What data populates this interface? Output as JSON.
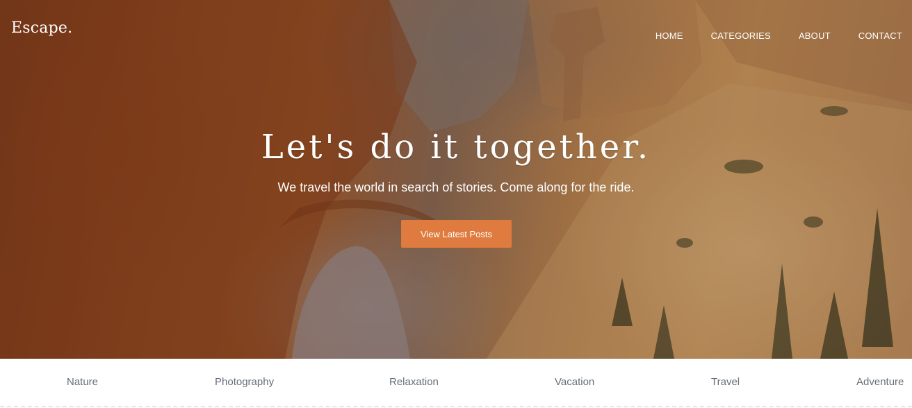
{
  "header": {
    "logo": "Escape.",
    "nav": [
      {
        "label": "HOME"
      },
      {
        "label": "CATEGORIES"
      },
      {
        "label": "ABOUT"
      },
      {
        "label": "CONTACT"
      }
    ]
  },
  "hero": {
    "headline": "Let's do it together.",
    "tagline": "We travel the world in search of stories. Come along for the ride.",
    "cta_label": "View Latest Posts"
  },
  "categories": [
    {
      "label": "Nature"
    },
    {
      "label": "Photography"
    },
    {
      "label": "Relaxation"
    },
    {
      "label": "Vacation"
    },
    {
      "label": "Travel"
    },
    {
      "label": "Adventure"
    }
  ],
  "colors": {
    "accent": "#e07b3f",
    "category_text": "#666d78",
    "hero_text": "#ffffff"
  }
}
